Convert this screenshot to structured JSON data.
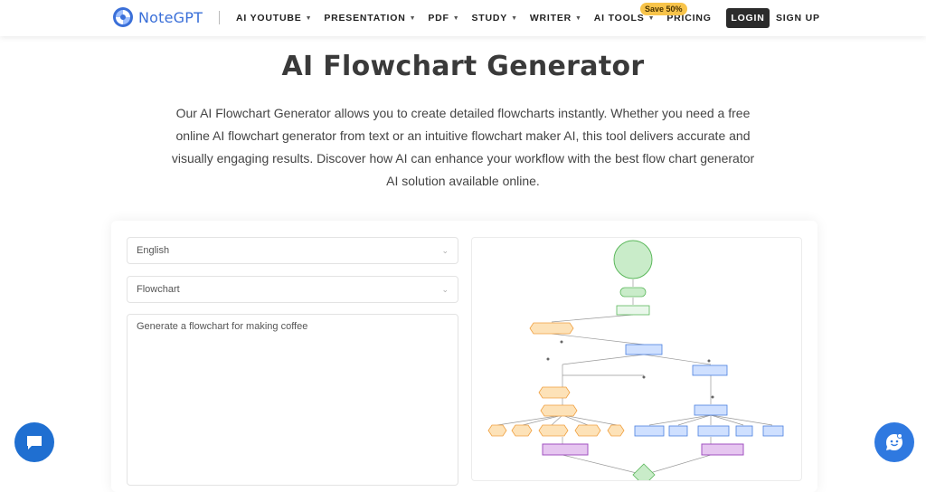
{
  "nav": {
    "brand": "NoteGPT",
    "items": [
      {
        "label": "AI YOUTUBE",
        "dropdown": true
      },
      {
        "label": "PRESENTATION",
        "dropdown": true
      },
      {
        "label": "PDF",
        "dropdown": true
      },
      {
        "label": "STUDY",
        "dropdown": true
      },
      {
        "label": "WRITER",
        "dropdown": true
      },
      {
        "label": "AI TOOLS",
        "dropdown": true
      },
      {
        "label": "PRICING",
        "dropdown": false
      }
    ],
    "badge": "Save 50%",
    "login": "LOGIN",
    "signup": "SIGN UP"
  },
  "hero": {
    "title": "AI Flowchart Generator",
    "description": "Our AI Flowchart Generator allows you to create detailed flowcharts instantly. Whether you need a free online AI flowchart generator from text or an intuitive flowchart maker AI, this tool delivers accurate and visually engaging results. Discover how AI can enhance your workflow with the best flow chart generator AI solution available online."
  },
  "form": {
    "language": "English",
    "chart_type": "Flowchart",
    "prompt": "Generate a flowchart for making coffee"
  },
  "colors": {
    "brand": "#3a6fd8",
    "badge": "#f8c44a",
    "login_bg": "#2b2b2b",
    "node_green": "#c9ecc9",
    "node_orange": "#fde2b8",
    "node_blue": "#cfe0ff",
    "node_purple": "#e6c6f0"
  },
  "icons": {
    "chat": "chat-bubble-icon",
    "help": "support-agent-icon",
    "chevron": "chevron-down-icon"
  }
}
